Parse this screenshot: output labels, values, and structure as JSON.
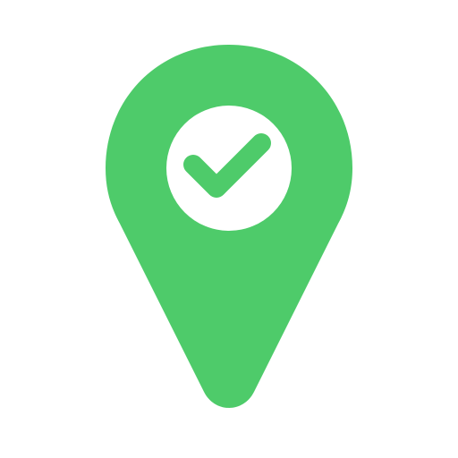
{
  "icon": {
    "name": "location-pin-check-icon",
    "colors": {
      "pin": "#4ECB6A",
      "inner_circle": "#FFFFFF",
      "check": "#4ECB6A",
      "background": "#FFFFFF"
    }
  }
}
